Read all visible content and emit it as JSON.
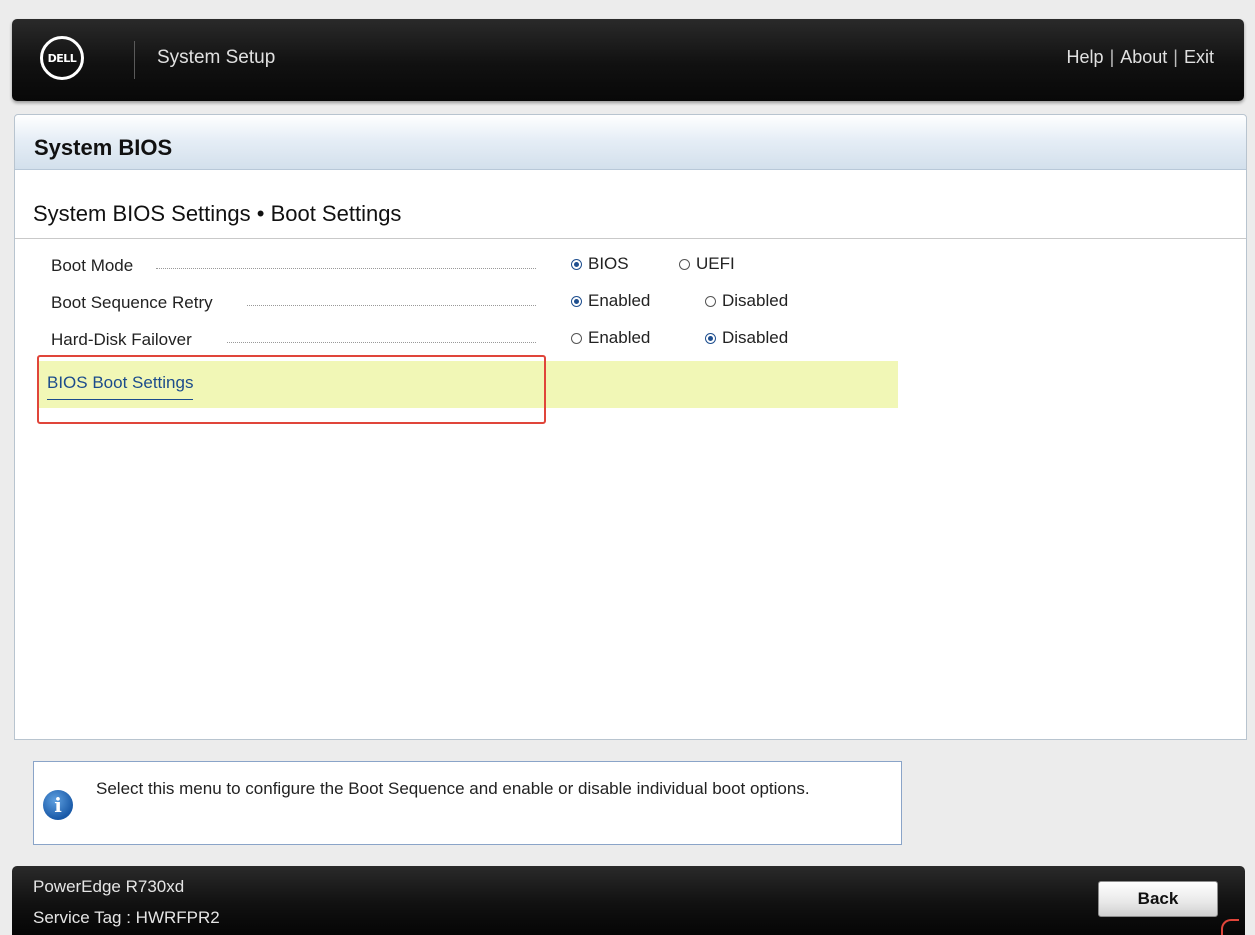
{
  "header": {
    "logo_text": "DELL",
    "app_title": "System Setup",
    "links": [
      "Help",
      "About",
      "Exit"
    ]
  },
  "panel": {
    "title": "System BIOS",
    "breadcrumb": "System BIOS Settings • Boot Settings"
  },
  "settings": [
    {
      "label": "Boot Mode",
      "options": [
        "BIOS",
        "UEFI"
      ],
      "selected": "BIOS"
    },
    {
      "label": "Boot Sequence Retry",
      "options": [
        "Enabled",
        "Disabled"
      ],
      "selected": "Enabled"
    },
    {
      "label": "Hard-Disk Failover",
      "options": [
        "Enabled",
        "Disabled"
      ],
      "selected": "Disabled"
    }
  ],
  "menu": {
    "bios_boot_settings": "BIOS Boot Settings"
  },
  "help": {
    "text": "Select this menu to configure the Boot Sequence and enable or disable individual boot options."
  },
  "footer": {
    "model": "PowerEdge R730xd",
    "service_tag": "Service Tag : HWRFPR2",
    "back_label": "Back"
  },
  "colors": {
    "header_bg": "#111111",
    "highlight": "#f1f7b6",
    "link": "#1c4c8c",
    "selection_outline": "#e0453a"
  }
}
